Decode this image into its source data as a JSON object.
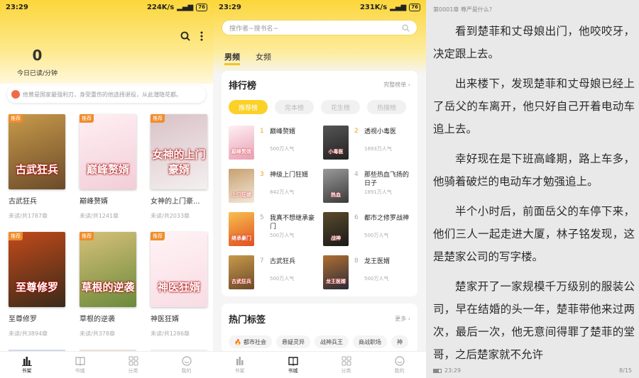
{
  "status": [
    {
      "time": "23:29",
      "speed": "224K/s",
      "battery": "76"
    },
    {
      "time": "23:29",
      "speed": "231K/s",
      "battery": "76"
    }
  ],
  "shelf": {
    "read_count": "0",
    "read_label": "今日已读/分钟",
    "notice": "他曾是国家最强利刃，身受重伤的他选择退役，从此潜隐花都。",
    "books": [
      {
        "title": "古武狂兵",
        "progress": "未读/共1787章",
        "tag": "推荐",
        "cover_text": "古武狂兵",
        "c1": "#6b4a2a",
        "c2": "#c89a4a"
      },
      {
        "title": "巅峰赘婿",
        "progress": "未读/共1241章",
        "tag": "推荐",
        "cover_text": "巅峰赘婿",
        "c1": "#f2cdd8",
        "c2": "#fff0f4"
      },
      {
        "title": "女神的上门豪...",
        "progress": "未读/共2033章",
        "tag": "推荐",
        "cover_text": "女神的上门豪婿",
        "c1": "#f4eff0",
        "c2": "#d9c2c6"
      },
      {
        "title": "至尊修罗",
        "progress": "未读/共3894章",
        "tag": "推荐",
        "cover_text": "至尊修罗",
        "c1": "#3a2a1a",
        "c2": "#c24a1a"
      },
      {
        "title": "草根的逆袭",
        "progress": "未读/共378章",
        "tag": "推荐",
        "cover_text": "草根的逆袭",
        "c1": "#6a8a3a",
        "c2": "#d8c07a"
      },
      {
        "title": "神医狂婿",
        "progress": "未读/共1286章",
        "tag": "推荐",
        "cover_text": "神医狂婿",
        "c1": "#f8dce4",
        "c2": "#fff3f6"
      }
    ]
  },
  "tabs": [
    "书架",
    "书城",
    "分类",
    "我的"
  ],
  "store": {
    "search_placeholder": "搜作者~搜书名~",
    "gender_tabs": [
      "男频",
      "女频"
    ],
    "rank_title": "排行榜",
    "rank_more": "完整榜单",
    "rank_pills": [
      "推荐榜",
      "完本榜",
      "花生榜",
      "热搜榜"
    ],
    "ranks": [
      {
        "num": "1",
        "name": "巅峰赘婿",
        "pop": "500万人气",
        "cover": "巅峰赘婿",
        "c1": "#e8a0b4",
        "c2": "#fff0f4"
      },
      {
        "num": "2",
        "name": "透视小毒医",
        "pop": "1693万人气",
        "cover": "小毒医",
        "c1": "#222",
        "c2": "#555"
      },
      {
        "num": "3",
        "name": "神级上门狂婿",
        "pop": "842万人气",
        "cover": "上门狂婿",
        "c1": "#f0e8d8",
        "c2": "#c8a070"
      },
      {
        "num": "4",
        "name": "那些热血飞扬的日子",
        "pop": "1891万人气",
        "cover": "热血",
        "c1": "#3a3a3a",
        "c2": "#9a9a9a"
      },
      {
        "num": "5",
        "name": "我真不想继承豪门",
        "pop": "500万人气",
        "cover": "继承豪门",
        "c1": "#e05020",
        "c2": "#f8c050"
      },
      {
        "num": "6",
        "name": "都市之修罗战神",
        "pop": "500万人气",
        "cover": "战神",
        "c1": "#1a1a1a",
        "c2": "#5a4a2a"
      },
      {
        "num": "7",
        "name": "古武狂兵",
        "pop": "500万人气",
        "cover": "古武狂兵",
        "c1": "#6b4a2a",
        "c2": "#c89a4a"
      },
      {
        "num": "8",
        "name": "龙王医婿",
        "pop": "500万人气",
        "cover": "龙王医婿",
        "c1": "#2a2a3a",
        "c2": "#b07030"
      }
    ],
    "hot_title": "热门标签",
    "hot_more": "更多",
    "hot_tags": [
      "都市社会",
      "悬疑灵异",
      "战神兵王",
      "商战职场",
      "神"
    ]
  },
  "reader": {
    "chapter": "第0001章 尊严是什么?",
    "paragraphs": [
      "看到楚菲和丈母娘出门，他咬咬牙，决定跟上去。",
      "出来楼下，发现楚菲和丈母娘已经上了岳父的车离开，他只好自己开着电动车追上去。",
      "幸好现在是下班高峰期，路上车多，他骑着破烂的电动车才勉强追上。",
      "半个小时后，前面岳父的车停下来，他们三人一起走进大厦，林子铭发现，这是楚家公司的写字楼。",
      "楚家开了一家规模千万级别的服装公司，早在结婚的头一年，楚菲带他来过两次，最后一次，他无意间得罪了楚菲的堂哥，之后楚家就不允许"
    ],
    "time": "23:29",
    "page": "8/15"
  }
}
